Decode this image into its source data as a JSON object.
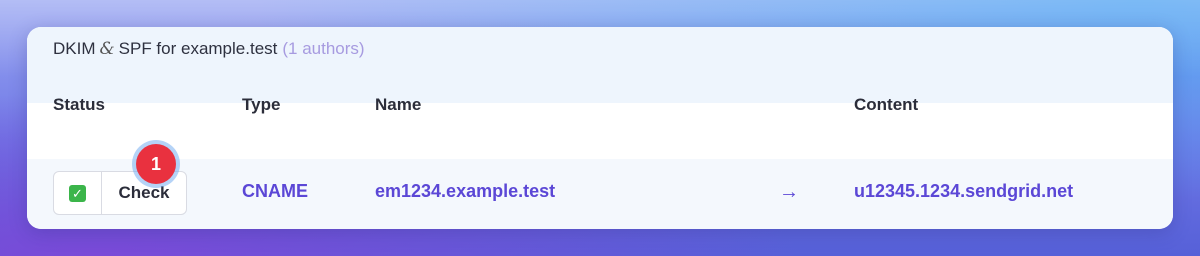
{
  "header": {
    "title_prefix": "DKIM",
    "amp": "&",
    "title_suffix": "SPF for example.test",
    "count": "(1 authors)"
  },
  "columns": {
    "status": "Status",
    "type": "Type",
    "name": "Name",
    "content": "Content"
  },
  "record": {
    "status_icon": "check-mark-icon",
    "check_label": "Check",
    "badge": "1",
    "type": "CNAME",
    "name": "em1234.example.test",
    "arrow": "→",
    "content": "u12345.1234.sendgrid.net"
  },
  "colors": {
    "accent": "#5b47d6",
    "badge": "#e9313f",
    "status_ok": "#3bb54a",
    "header_bg": "#eef5fd"
  }
}
